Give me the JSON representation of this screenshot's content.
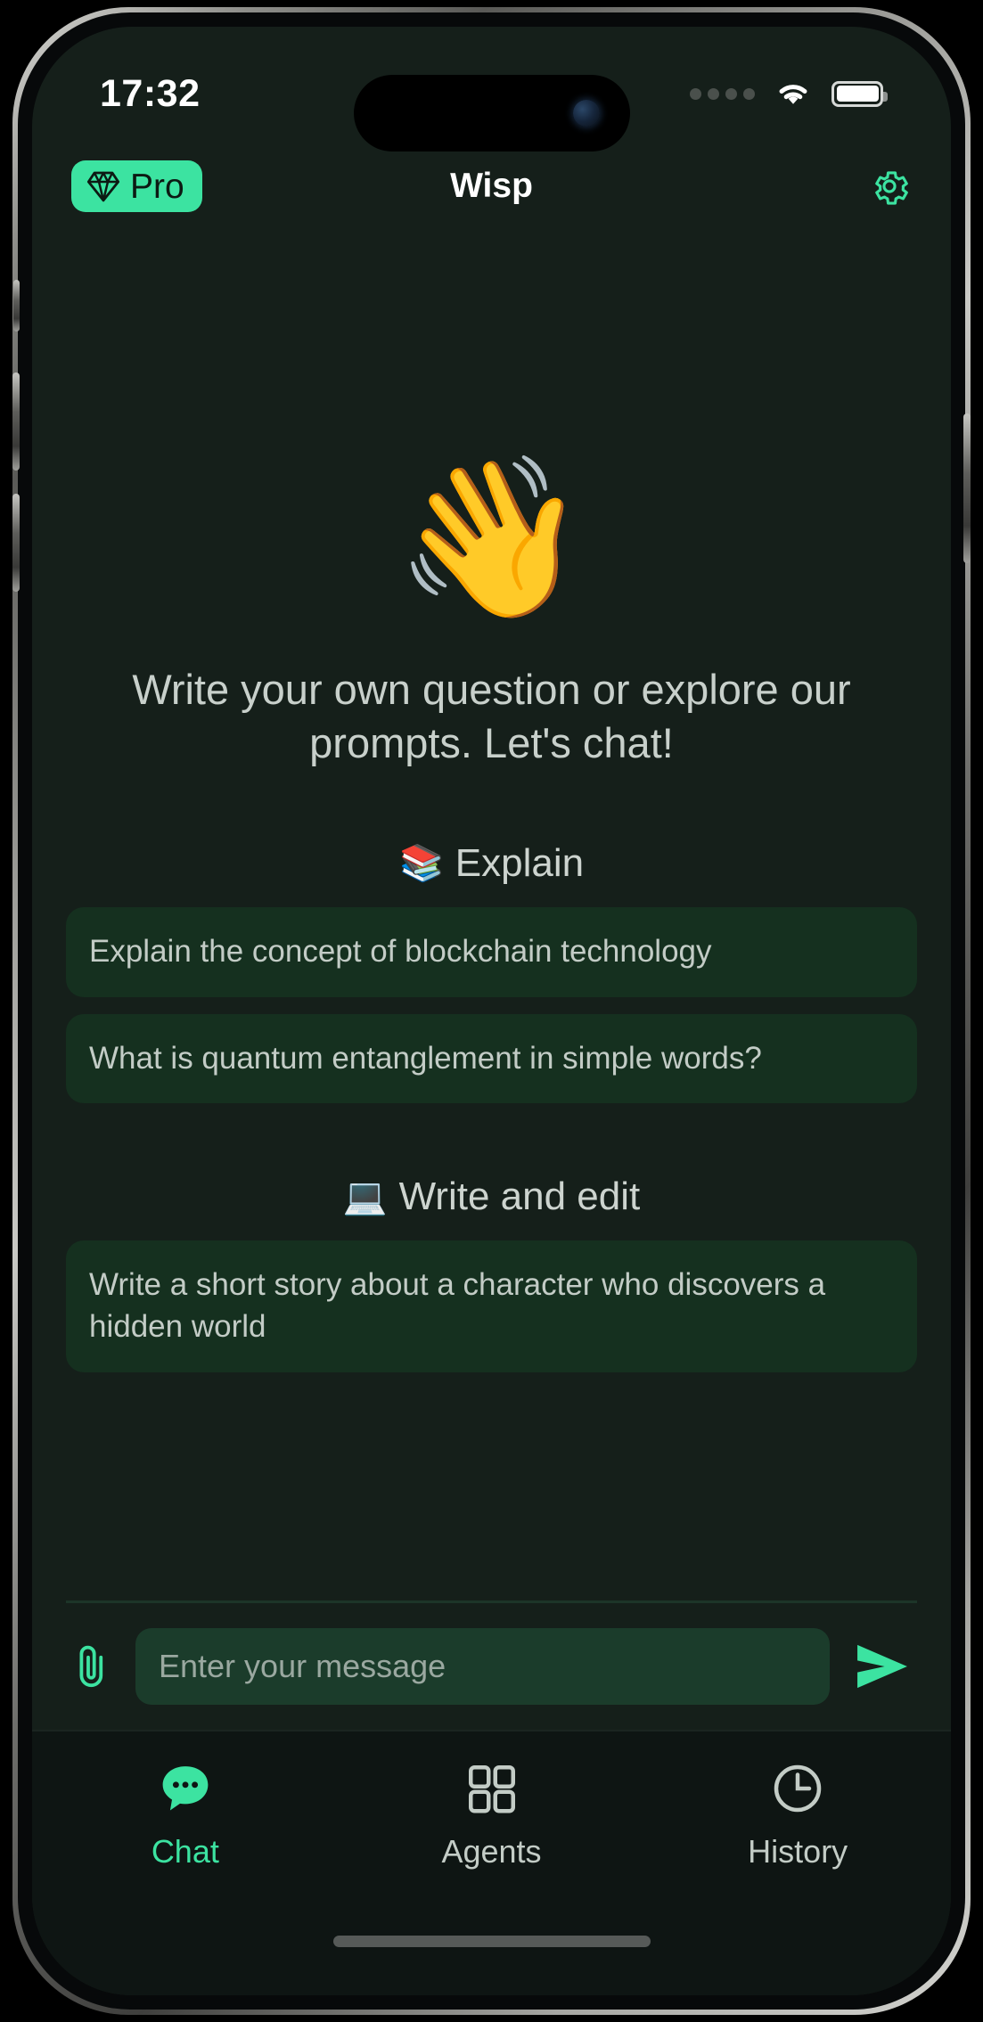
{
  "status_bar": {
    "time": "17:32",
    "signal_icon": "signal-dots-icon",
    "wifi_icon": "wifi-icon",
    "battery_icon": "battery-full-icon"
  },
  "header": {
    "pro_label": "Pro",
    "pro_icon": "diamond-icon",
    "title": "Wisp",
    "settings_icon": "gear-icon"
  },
  "hero": {
    "emoji": "👋",
    "text": "Write your own question or explore our prompts. Let's chat!"
  },
  "sections": [
    {
      "emoji": "📚",
      "title": "Explain",
      "prompts": [
        "Explain the concept of blockchain technology",
        "What is quantum entanglement in simple words?"
      ]
    },
    {
      "emoji": "💻",
      "title": "Write and edit",
      "prompts": [
        "Write a short story about a character who discovers a hidden world"
      ]
    }
  ],
  "input_bar": {
    "attach_icon": "paperclip-icon",
    "placeholder": "Enter your message",
    "value": "",
    "send_icon": "send-arrow-icon"
  },
  "tab_bar": {
    "tabs": [
      {
        "label": "Chat",
        "icon": "chat-bubble-icon",
        "active": true
      },
      {
        "label": "Agents",
        "icon": "grid-icon",
        "active": false
      },
      {
        "label": "History",
        "icon": "clock-icon",
        "active": false
      }
    ]
  },
  "colors": {
    "accent": "#3ce3a1",
    "screen_bg": "#151f1a",
    "card_bg": "#15301f",
    "input_bg": "#1b3c2b",
    "text_primary": "#ffffff",
    "text_muted": "#c8d0cb"
  }
}
